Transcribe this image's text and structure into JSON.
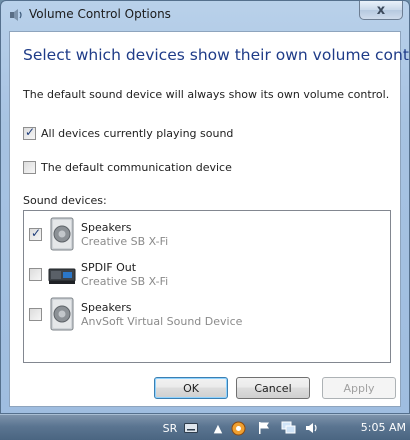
{
  "window": {
    "title": "Volume Control Options",
    "close_label": "x"
  },
  "main": {
    "heading": "Select which devices show their own volume control",
    "description": "The default sound device will always show its own volume control.",
    "options": [
      {
        "label": "All devices currently playing sound",
        "checked": true
      },
      {
        "label": "The default communication device",
        "checked": false
      }
    ],
    "sound_devices_label": "Sound devices:",
    "devices": [
      {
        "name": "Speakers",
        "subtitle": "Creative SB X-Fi",
        "checked": true,
        "icon": "speaker-icon"
      },
      {
        "name": "SPDIF Out",
        "subtitle": "Creative SB X-Fi",
        "checked": false,
        "icon": "digital-output-icon"
      },
      {
        "name": "Speakers",
        "subtitle": "AnvSoft Virtual Sound Device",
        "checked": false,
        "icon": "speaker-icon"
      }
    ]
  },
  "buttons": {
    "ok": "OK",
    "cancel": "Cancel",
    "apply": "Apply"
  },
  "taskbar": {
    "language": "SR",
    "clock": "5:05 AM"
  }
}
